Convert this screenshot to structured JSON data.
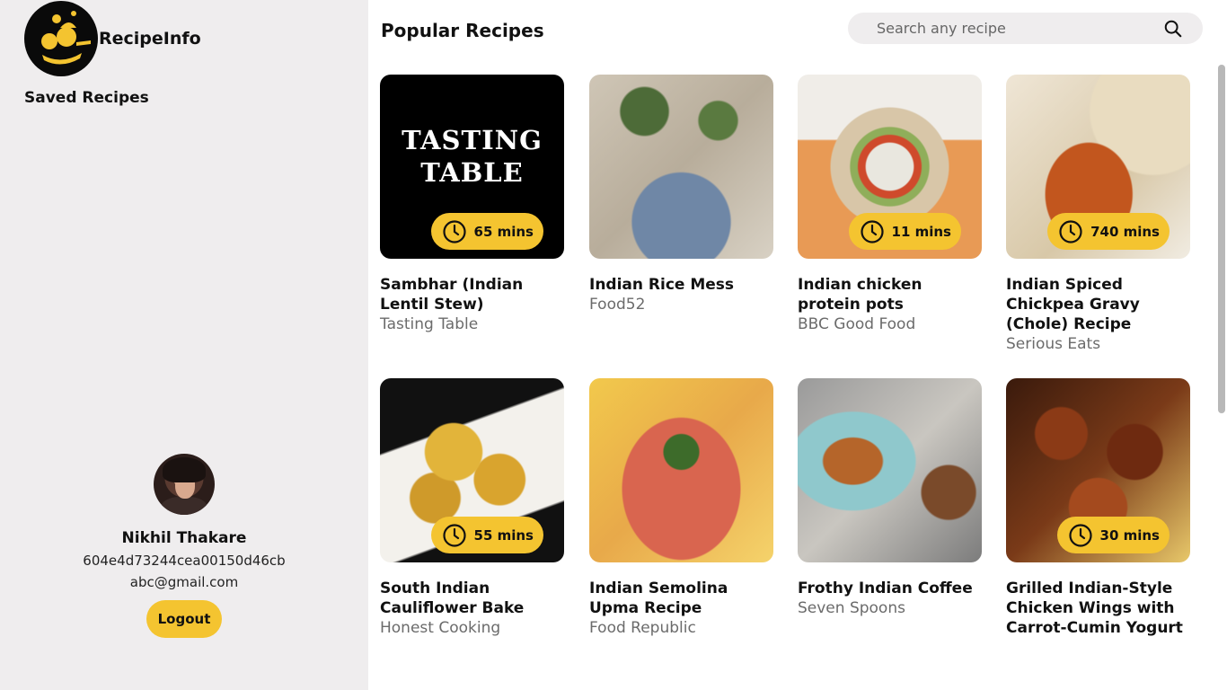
{
  "brand": {
    "name": "RecipeInfo"
  },
  "nav": {
    "saved": "Saved Recipes"
  },
  "profile": {
    "name": "Nikhil Thakare",
    "id": "604e4d73244cea00150d46cb",
    "email": "abc@gmail.com",
    "logout": "Logout"
  },
  "main": {
    "title": "Popular Recipes",
    "search_placeholder": "Search any recipe"
  },
  "recipes": [
    {
      "title": "Sambhar (Indian Lentil Stew)",
      "source": "Tasting Table",
      "time": "65 mins",
      "logo_line1": "TASTING",
      "logo_line2": "TABLE"
    },
    {
      "title": "Indian Rice Mess",
      "source": "Food52",
      "time": ""
    },
    {
      "title": "Indian chicken protein pots",
      "source": "BBC Good Food",
      "time": "11 mins"
    },
    {
      "title": "Indian Spiced Chickpea Gravy (Chole) Recipe",
      "source": "Serious Eats",
      "time": "740 mins"
    },
    {
      "title": "South Indian Cauliflower Bake",
      "source": "Honest Cooking",
      "time": "55 mins"
    },
    {
      "title": "Indian Semolina Upma Recipe",
      "source": "Food Republic",
      "time": ""
    },
    {
      "title": "Frothy Indian Coffee",
      "source": "Seven Spoons",
      "time": ""
    },
    {
      "title": "Grilled Indian-Style Chicken Wings with Carrot-Cumin Yogurt",
      "source": "",
      "time": "30 mins"
    }
  ],
  "colors": {
    "accent": "#f4c430",
    "sidebar": "#efedee",
    "muted_text": "#6b6b6b"
  },
  "icons": {
    "search": "search-icon",
    "clock": "clock-icon",
    "logo": "chef-logo-icon"
  }
}
